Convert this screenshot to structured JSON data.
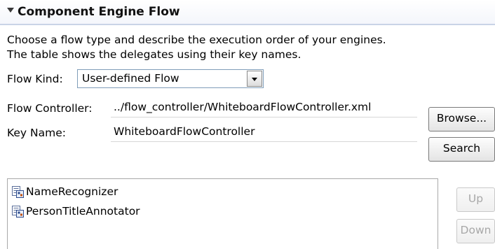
{
  "section": {
    "title": "Component Engine Flow"
  },
  "description": {
    "line1": "Choose a flow type and describe the execution order of your engines.",
    "line2": "The table shows the delegates using their key names."
  },
  "flow_kind": {
    "label": "Flow Kind:",
    "selected": "User-defined Flow"
  },
  "flow_controller": {
    "label": "Flow Controller:",
    "value": "../flow_controller/WhiteboardFlowController.xml"
  },
  "key_name": {
    "label": "Key Name:",
    "value": "WhiteboardFlowController"
  },
  "buttons": {
    "browse": "Browse...",
    "search": "Search",
    "up": "Up",
    "down": "Down"
  },
  "delegates": [
    {
      "name": "NameRecognizer",
      "icon": "delegate-descriptor-icon"
    },
    {
      "name": "PersonTitleAnnotator",
      "icon": "delegate-descriptor-icon"
    }
  ]
}
